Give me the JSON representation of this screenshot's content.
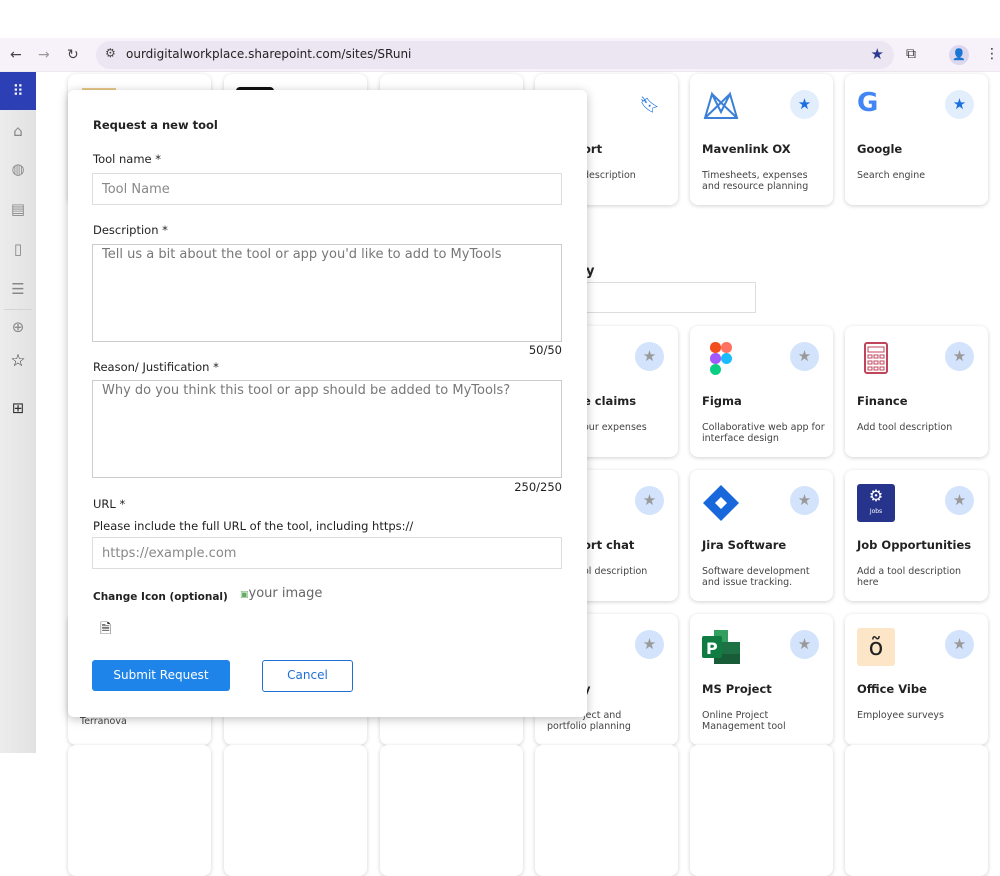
{
  "browser": {
    "url": "ourdigitalworkplace.sharepoint.com/sites/SRuni",
    "profile_initial": "👤"
  },
  "rail": {
    "icons": [
      "waffle-icon",
      "home-icon",
      "globe-icon",
      "news-icon",
      "file-icon",
      "list-icon",
      "add-icon",
      "star-icon",
      "apps-icon"
    ]
  },
  "page": {
    "section_title_fragment": "y"
  },
  "cards": [
    {
      "name": "ort",
      "desc": "description",
      "fav": "bookmark"
    },
    {
      "name": "Mavenlink OX",
      "desc": "Timesheets, expenses and resource planning",
      "fav": "on"
    },
    {
      "name": "Google",
      "desc": "Search engine",
      "fav": "on"
    },
    {
      "name": "e claims",
      "desc": "our expenses",
      "fav": "off"
    },
    {
      "name": "Figma",
      "desc": "Collaborative web app for interface design",
      "fav": "off"
    },
    {
      "name": "Finance",
      "desc": "Add tool description",
      "fav": "off"
    },
    {
      "name": "ort chat",
      "desc": "ol description",
      "fav": "off"
    },
    {
      "name": "Jira Software",
      "desc": "Software development and issue tracking.",
      "fav": "off"
    },
    {
      "name": "Job Opportunities",
      "desc": "Add a tool description here",
      "fav": "off"
    },
    {
      "name": "y",
      "desc": "ject and portfolio planning",
      "fav": "off"
    },
    {
      "name": "MS Project",
      "desc": "Online Project Management tool",
      "fav": "off"
    },
    {
      "name": "Office Vibe",
      "desc": "Employee surveys",
      "fav": "off"
    }
  ],
  "hidden_card_text": "Terranova",
  "modal": {
    "title": "Request a new tool",
    "tool_name_label": "Tool name *",
    "tool_name_placeholder": "Tool Name",
    "description_label": "Description *",
    "description_placeholder": "Tell us a bit about the tool or app you'd like to add to MyTools",
    "description_count": "50/50",
    "reason_label": "Reason/ Justification *",
    "reason_placeholder": "Why do you think this tool or app should be added to MyTools?",
    "reason_count": "250/250",
    "url_label": "URL *",
    "url_hint": "Please include the full URL of the tool, including https://",
    "url_placeholder": "https://example.com",
    "icon_label": "Change Icon (optional)",
    "image_alt": "your image",
    "submit": "Submit Request",
    "cancel": "Cancel"
  },
  "colors": {
    "accent": "#1f84ea",
    "rail_active": "#2c3fb5",
    "fav_on": "#1a6fe0"
  }
}
